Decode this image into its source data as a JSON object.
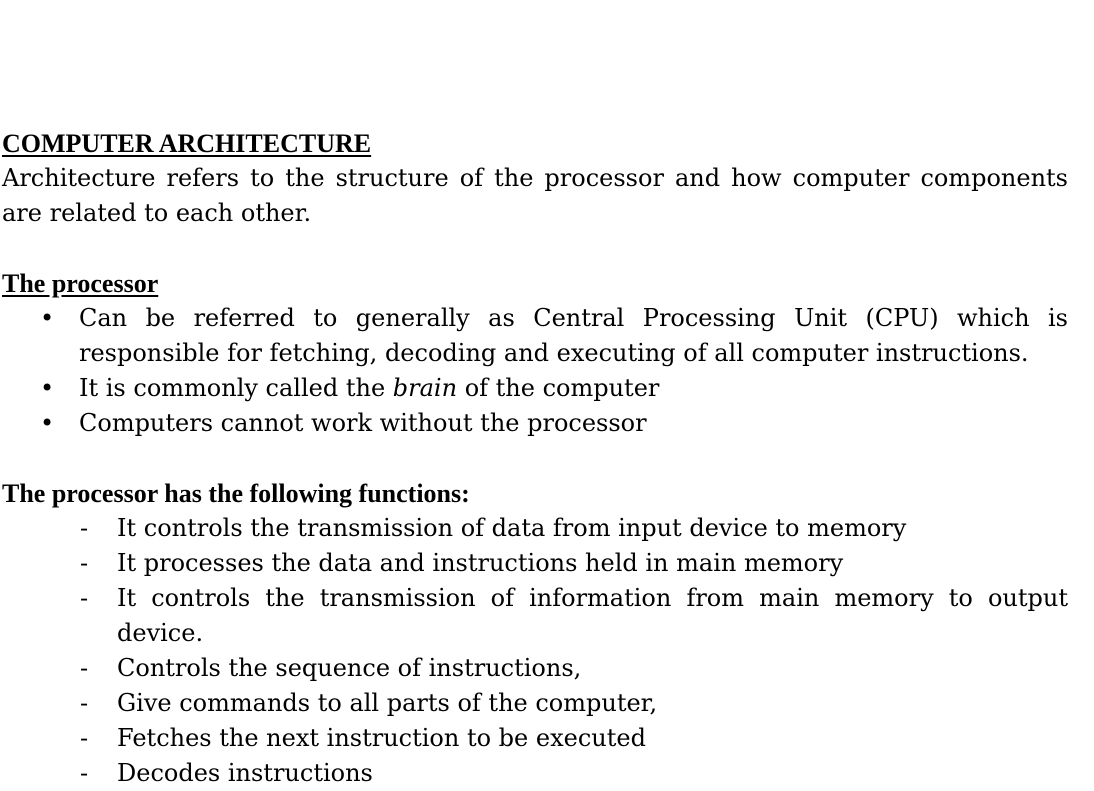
{
  "title": "COMPUTER ARCHITECTURE",
  "intro": "Architecture refers to the structure of the processor and how computer components are related to each other.",
  "processor_section": {
    "heading": "The processor",
    "bullets": [
      {
        "text": "Can be referred to generally as Central Processing Unit (CPU) which is responsible for fetching, decoding and executing of all computer instructions."
      },
      {
        "before": "It is commonly called the ",
        "em": "brain",
        "after": " of the computer"
      },
      {
        "text": "Computers cannot work without the processor"
      }
    ]
  },
  "functions_section": {
    "heading": "The processor has the following functions:",
    "items": [
      "It controls the transmission of data from input device to memory",
      "It processes the data and instructions held in main memory",
      "It controls the transmission of information from main memory to output device.",
      "Controls the sequence of instructions,",
      "Give commands to all parts of the computer,",
      "Fetches the next instruction to be executed",
      "Decodes instructions"
    ]
  },
  "markers": {
    "bullet": "•",
    "dash": "-"
  }
}
